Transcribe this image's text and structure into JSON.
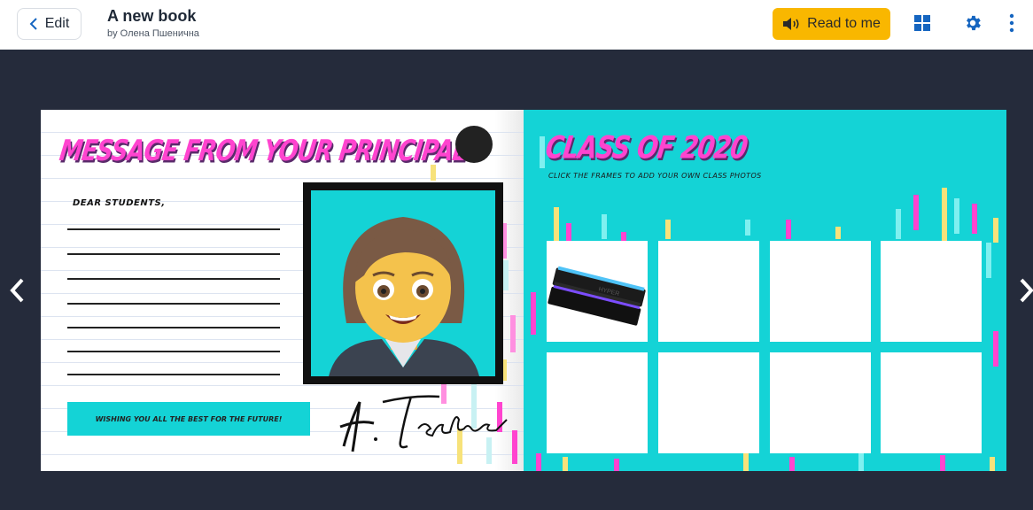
{
  "header": {
    "edit_label": "Edit",
    "title": "A new book",
    "author": "by Олена Пшенична",
    "read_label": "Read to me",
    "accent": "#f9b700",
    "icon_color": "#1565c0"
  },
  "left_page": {
    "headline": "MESSAGE FROM YOUR PRINCIPAL",
    "greeting": "DEAR STUDENTS,",
    "wish": "WISHING YOU ALL THE BEST FOR THE FUTURE!",
    "signature": "A. Teacher"
  },
  "right_page": {
    "headline": "CLASS OF 2020",
    "hint": "CLICK THE FRAMES TO ADD YOUR OWN CLASS PHOTOS",
    "frames_count_label": "8 photo frames"
  },
  "colors": {
    "page_bg": "#252b3b",
    "cyan": "#14d3d6",
    "pink": "#ff44cf"
  }
}
